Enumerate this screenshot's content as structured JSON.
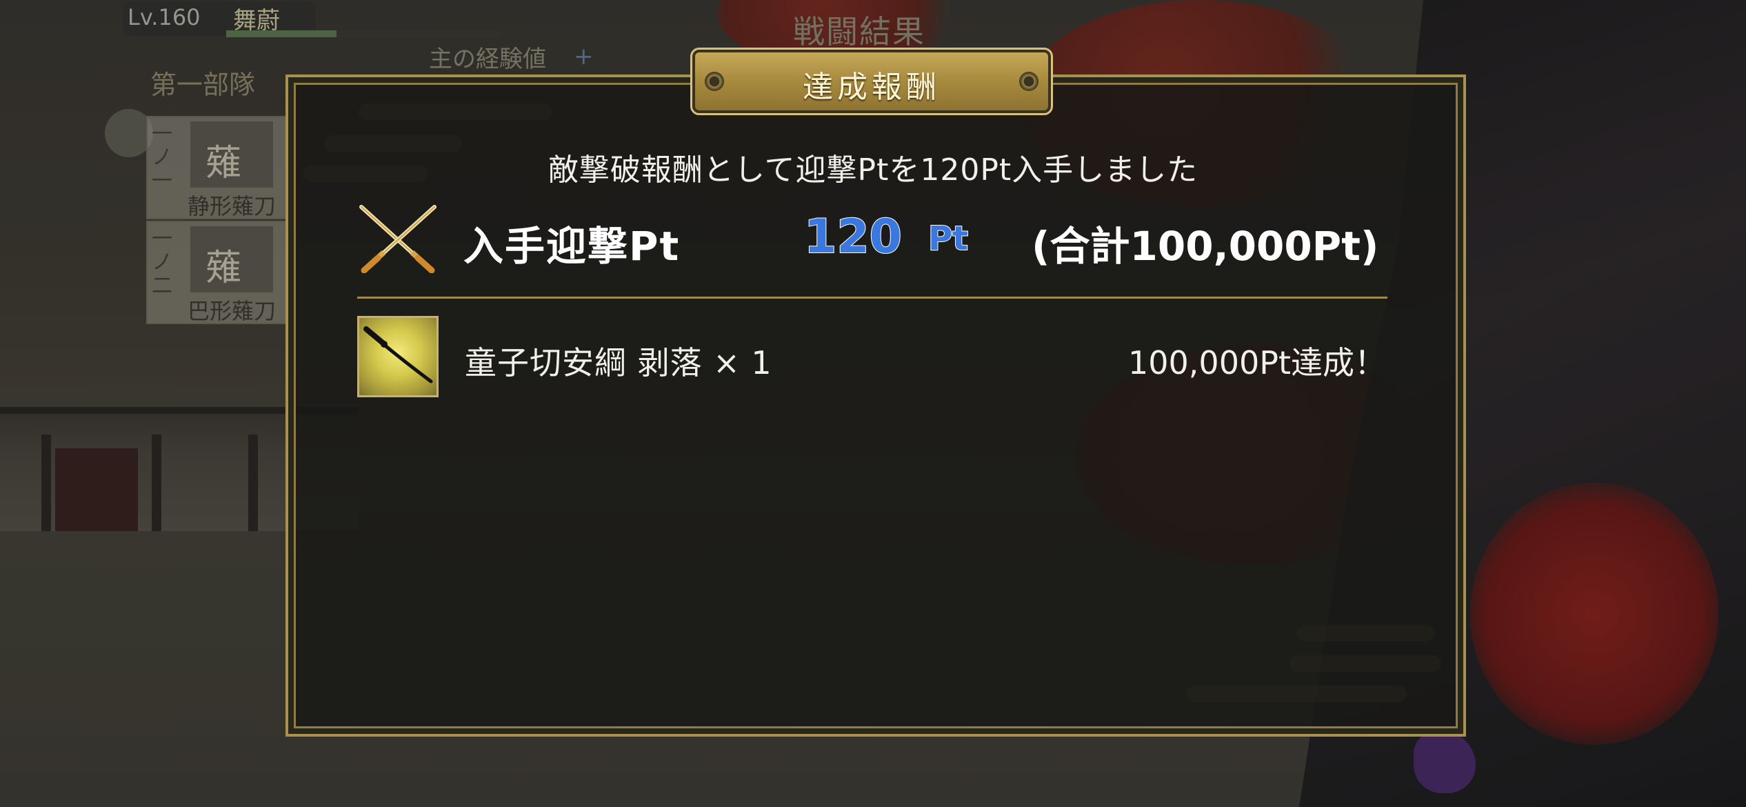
{
  "background": {
    "player": {
      "level": "Lv.160",
      "name": "舞蔚",
      "exp_fill": 0.4
    },
    "battle_result_title": "戦闘結果",
    "exp_label": "主の経験値",
    "exp_plus": "+",
    "squad_name": "第一部隊",
    "slots": [
      {
        "number": "一ノ一",
        "portrait_char": "薙",
        "name": "静形薙刀"
      },
      {
        "number": "一ノ二",
        "portrait_char": "薙",
        "name": "巴形薙刀"
      }
    ]
  },
  "dialog": {
    "title": "達成報酬",
    "message": "敵撃破報酬として迎撃Ptを120Pt入手しました",
    "points": {
      "icon": "crossed-swords-icon",
      "label": "入手迎撃Pt",
      "value": "120",
      "unit": "Pt",
      "total": "(合計100,000Pt)"
    },
    "rewards": [
      {
        "icon": "sword-item-icon",
        "name": "童子切安綱 剥落 × 1",
        "condition": "100,000Pt達成！"
      }
    ]
  },
  "colors": {
    "gold_border": "#a8924f",
    "panel_bg": "#181816",
    "points_blue": "#3a78e0",
    "text": "#f2f0ea"
  }
}
